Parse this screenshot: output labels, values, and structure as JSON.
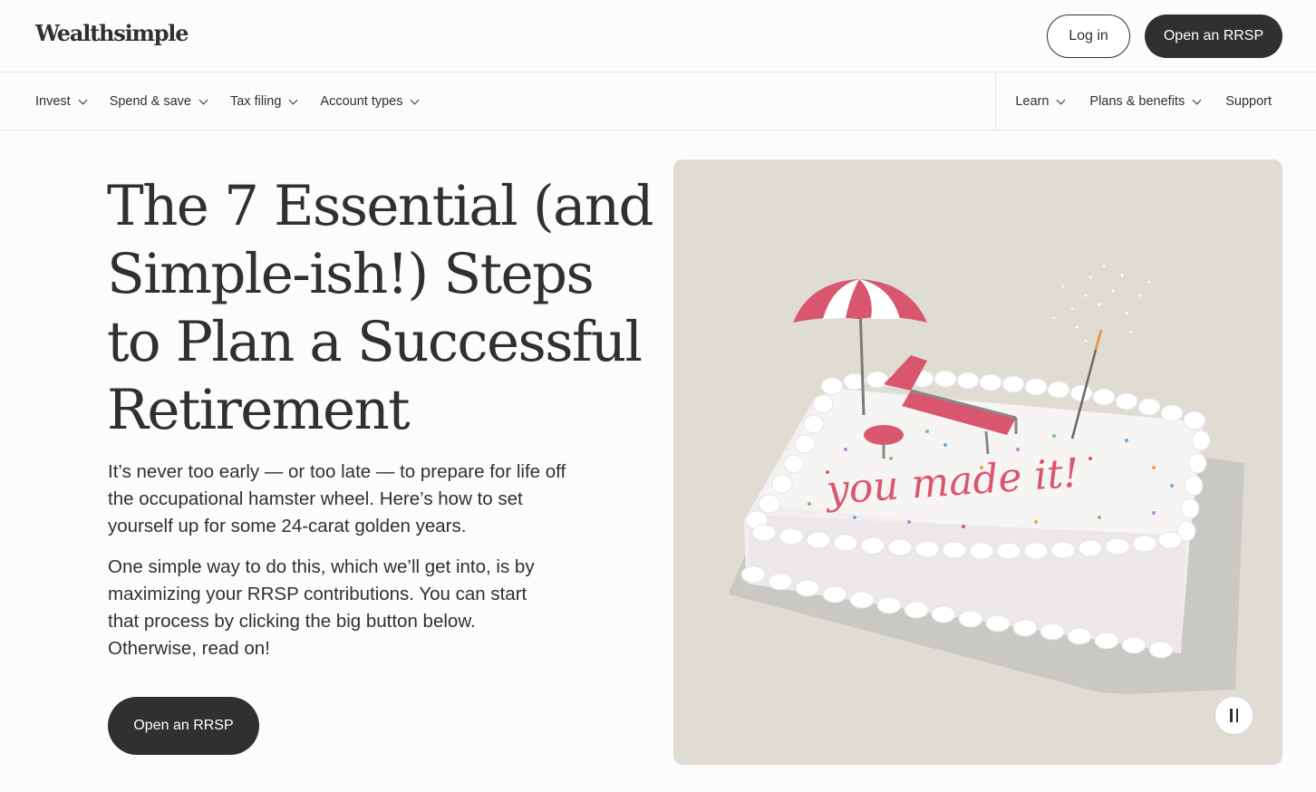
{
  "header": {
    "logo": "Wealthsimple",
    "login_label": "Log in",
    "open_rrsp_label": "Open an RRSP"
  },
  "nav": {
    "left": [
      {
        "label": "Invest"
      },
      {
        "label": "Spend & save"
      },
      {
        "label": "Tax filing"
      },
      {
        "label": "Account types"
      }
    ],
    "right": [
      {
        "label": "Learn",
        "has_dropdown": true
      },
      {
        "label": "Plans & benefits",
        "has_dropdown": true
      },
      {
        "label": "Support",
        "has_dropdown": false
      }
    ]
  },
  "hero": {
    "title": "The 7 Essential (and Simple-ish!) Steps to Plan a Successful Retirement",
    "intro": "It’s never too early — or too late — to prepare for life off the occupational hamster wheel. Here’s how to set yourself up for some 24-carat golden years.",
    "body": "One simple way to do this, which we’ll get into, is by maximizing your RRSP contributions. You can start that process by clicking the big button below. Otherwise, read on!",
    "cta_label": "Open an RRSP",
    "image_text": "you made it!",
    "pause_icon": "pause-icon"
  },
  "colors": {
    "text": "#32302f",
    "button_dark": "#32302f",
    "media_bg": "#dfddd3",
    "accent_pink": "#d9576e"
  }
}
